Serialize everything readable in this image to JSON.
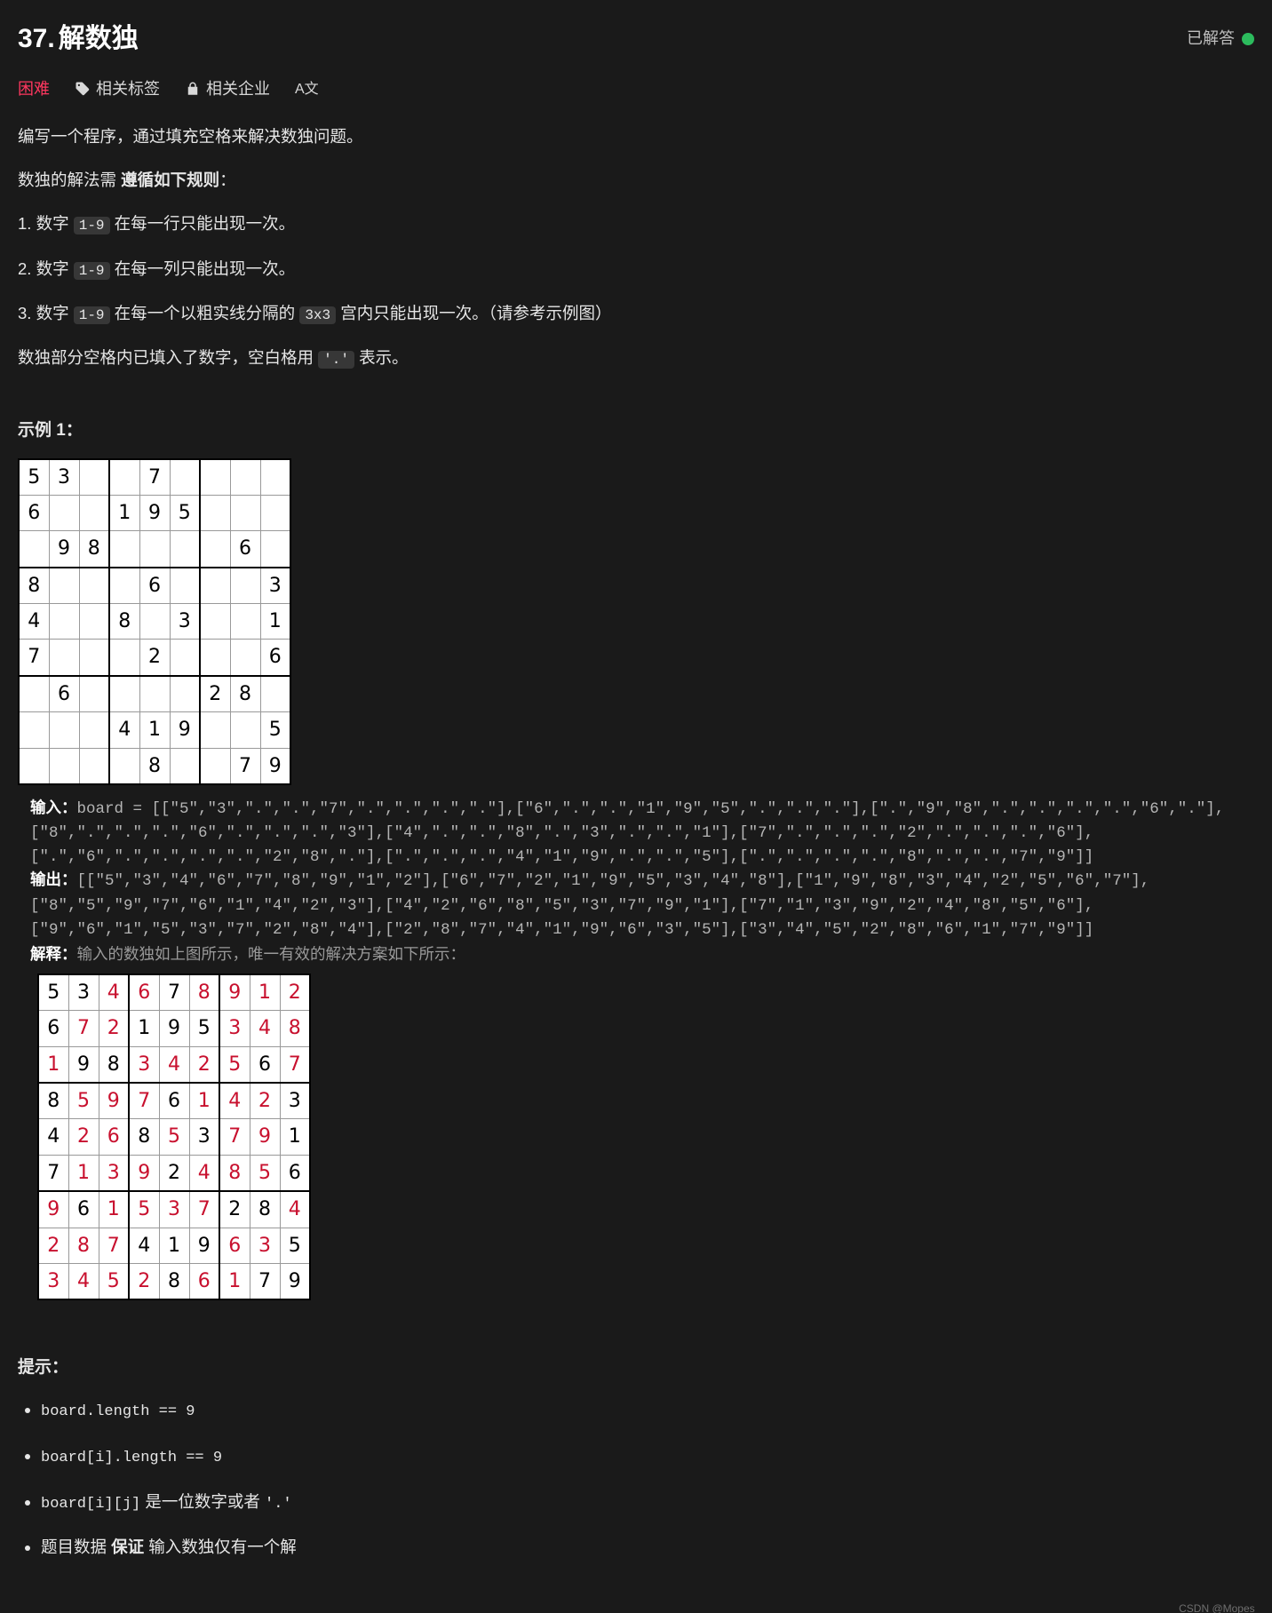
{
  "header": {
    "number": "37.",
    "title": "解数独",
    "solved_label": "已解答"
  },
  "tabs": {
    "difficulty": "困难",
    "tags": "相关标签",
    "companies": "相关企业",
    "translate": "A文"
  },
  "body": {
    "intro": "编写一个程序，通过填充空格来解决数独问题。",
    "rules_lead_a": "数独的解法需 ",
    "rules_lead_b": "遵循如下规则",
    "rules_lead_c": "：",
    "rule1_a": "1. 数字 ",
    "rule1_code": "1-9",
    "rule1_b": " 在每一行只能出现一次。",
    "rule2_a": "2. 数字 ",
    "rule2_code": "1-9",
    "rule2_b": " 在每一列只能出现一次。",
    "rule3_a": "3. 数字 ",
    "rule3_code": "1-9",
    "rule3_b": " 在每一个以粗实线分隔的 ",
    "rule3_code2": "3x3",
    "rule3_c": " 宫内只能出现一次。（请参考示例图）",
    "blank_a": "数独部分空格内已填入了数字，空白格用 ",
    "blank_code": "'.'",
    "blank_b": " 表示。"
  },
  "example": {
    "heading": "示例 1：",
    "input_label": "输入：",
    "input_text": "board = [[\"5\",\"3\",\".\",\".\",\"7\",\".\",\".\",\".\",\".\"],[\"6\",\".\",\".\",\"1\",\"9\",\"5\",\".\",\".\",\".\"],[\".\",\"9\",\"8\",\".\",\".\",\".\",\".\",\"6\",\".\"],[\"8\",\".\",\".\",\".\",\"6\",\".\",\".\",\".\",\"3\"],[\"4\",\".\",\".\",\"8\",\".\",\"3\",\".\",\".\",\"1\"],[\"7\",\".\",\".\",\".\",\"2\",\".\",\".\",\".\",\"6\"],[\".\",\"6\",\".\",\".\",\".\",\".\",\"2\",\"8\",\".\"],[\".\",\".\",\".\",\"4\",\"1\",\"9\",\".\",\".\",\"5\"],[\".\",\".\",\".\",\".\",\"8\",\".\",\".\",\"7\",\"9\"]]",
    "output_label": "输出：",
    "output_text": "[[\"5\",\"3\",\"4\",\"6\",\"7\",\"8\",\"9\",\"1\",\"2\"],[\"6\",\"7\",\"2\",\"1\",\"9\",\"5\",\"3\",\"4\",\"8\"],[\"1\",\"9\",\"8\",\"3\",\"4\",\"2\",\"5\",\"6\",\"7\"],[\"8\",\"5\",\"9\",\"7\",\"6\",\"1\",\"4\",\"2\",\"3\"],[\"4\",\"2\",\"6\",\"8\",\"5\",\"3\",\"7\",\"9\",\"1\"],[\"7\",\"1\",\"3\",\"9\",\"2\",\"4\",\"8\",\"5\",\"6\"],[\"9\",\"6\",\"1\",\"5\",\"3\",\"7\",\"2\",\"8\",\"4\"],[\"2\",\"8\",\"7\",\"4\",\"1\",\"9\",\"6\",\"3\",\"5\"],[\"3\",\"4\",\"5\",\"2\",\"8\",\"6\",\"1\",\"7\",\"9\"]]",
    "explain_label": "解释：",
    "explain_text": "输入的数独如上图所示，唯一有效的解决方案如下所示："
  },
  "sudoku_input": [
    [
      "5",
      "3",
      "",
      "",
      "7",
      "",
      "",
      "",
      ""
    ],
    [
      "6",
      "",
      "",
      "1",
      "9",
      "5",
      "",
      "",
      ""
    ],
    [
      "",
      "9",
      "8",
      "",
      "",
      "",
      "",
      "6",
      ""
    ],
    [
      "8",
      "",
      "",
      "",
      "6",
      "",
      "",
      "",
      "3"
    ],
    [
      "4",
      "",
      "",
      "8",
      "",
      "3",
      "",
      "",
      "1"
    ],
    [
      "7",
      "",
      "",
      "",
      "2",
      "",
      "",
      "",
      "6"
    ],
    [
      "",
      "6",
      "",
      "",
      "",
      "",
      "2",
      "8",
      ""
    ],
    [
      "",
      "",
      "",
      "4",
      "1",
      "9",
      "",
      "",
      "5"
    ],
    [
      "",
      "",
      "",
      "",
      "8",
      "",
      "",
      "7",
      "9"
    ]
  ],
  "sudoku_output": [
    [
      "5",
      "3",
      "4",
      "6",
      "7",
      "8",
      "9",
      "1",
      "2"
    ],
    [
      "6",
      "7",
      "2",
      "1",
      "9",
      "5",
      "3",
      "4",
      "8"
    ],
    [
      "1",
      "9",
      "8",
      "3",
      "4",
      "2",
      "5",
      "6",
      "7"
    ],
    [
      "8",
      "5",
      "9",
      "7",
      "6",
      "1",
      "4",
      "2",
      "3"
    ],
    [
      "4",
      "2",
      "6",
      "8",
      "5",
      "3",
      "7",
      "9",
      "1"
    ],
    [
      "7",
      "1",
      "3",
      "9",
      "2",
      "4",
      "8",
      "5",
      "6"
    ],
    [
      "9",
      "6",
      "1",
      "5",
      "3",
      "7",
      "2",
      "8",
      "4"
    ],
    [
      "2",
      "8",
      "7",
      "4",
      "1",
      "9",
      "6",
      "3",
      "5"
    ],
    [
      "3",
      "4",
      "5",
      "2",
      "8",
      "6",
      "1",
      "7",
      "9"
    ]
  ],
  "hints": {
    "heading": "提示：",
    "h1": "board.length == 9",
    "h2": "board[i].length == 9",
    "h3_a": "board[i][j]",
    "h3_b": " 是一位数字或者 ",
    "h3_c": "'.'",
    "h4_a": "题目数据 ",
    "h4_b": "保证",
    "h4_c": " 输入数独仅有一个解"
  },
  "watermark": "CSDN @Mopes__"
}
